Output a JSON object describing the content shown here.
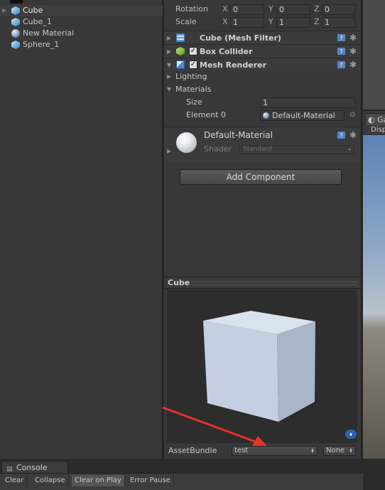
{
  "hierarchy": {
    "items": [
      {
        "label": "Cube",
        "icon": "cube-icon",
        "selected": true
      },
      {
        "label": "Cube_1",
        "icon": "cube-icon",
        "selected": false
      },
      {
        "label": "New Material",
        "icon": "material-sphere-icon",
        "selected": false
      },
      {
        "label": "Sphere_1",
        "icon": "cube-icon",
        "selected": false
      }
    ]
  },
  "inspector": {
    "transform": {
      "rotation": {
        "label": "Rotation",
        "x": "0",
        "y": "0",
        "z": "0"
      },
      "scale": {
        "label": "Scale",
        "x": "1",
        "y": "1",
        "z": "1"
      },
      "axes": {
        "x": "X",
        "y": "Y",
        "z": "Z"
      }
    },
    "components": [
      {
        "title": "Cube (Mesh Filter)",
        "icon": "mesh-filter-icon",
        "has_checkbox": false
      },
      {
        "title": "Box Collider",
        "icon": "box-collider-icon",
        "has_checkbox": true
      },
      {
        "title": "Mesh Renderer",
        "icon": "mesh-renderer-icon",
        "has_checkbox": true
      }
    ],
    "mesh_renderer": {
      "lighting_label": "Lighting",
      "materials_label": "Materials",
      "size_label": "Size",
      "size_value": "1",
      "element0_label": "Element 0",
      "element0_value": "Default-Material"
    },
    "material": {
      "name": "Default-Material",
      "shader_label": "Shader",
      "shader_value": "Standard"
    },
    "add_component_label": "Add Component",
    "help_symbol": "?",
    "gear_symbol": "✱",
    "check_symbol": "✓"
  },
  "preview": {
    "title": "Cube",
    "asset_bundle_label": "AssetBundle",
    "asset_bundle_value": "test",
    "variant_value": "None",
    "annotation_color": "#e8312a",
    "cube_color": "#c9d6e8"
  },
  "game_view": {
    "tab_label": "Ga",
    "display_label": "Disp"
  },
  "console": {
    "tab_label": "Console",
    "buttons": [
      "Clear",
      "Collapse",
      "Clear on Play",
      "Error Pause"
    ],
    "active_button": "Clear on Play"
  }
}
